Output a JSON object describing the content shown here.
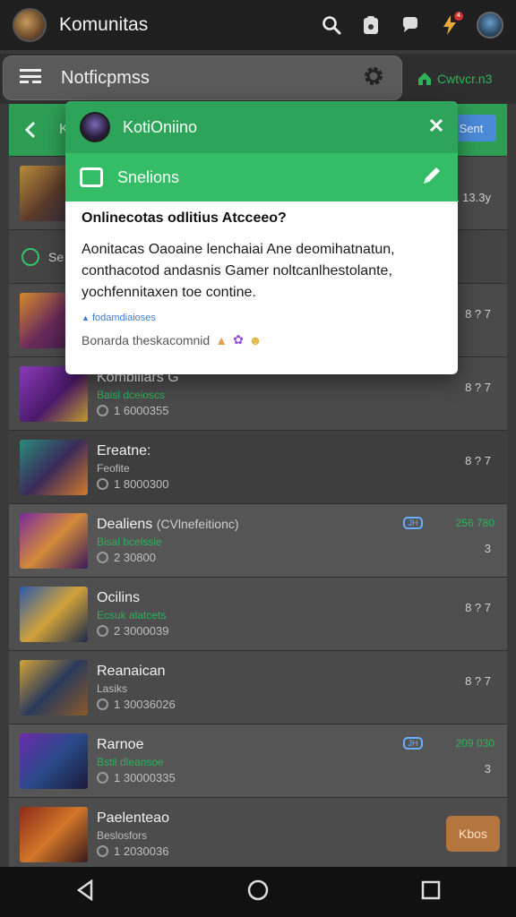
{
  "appbar": {
    "title": "Komunitas",
    "notification_count": "4"
  },
  "notifbar": {
    "title": "Notficpmss",
    "action_label": "Cwtvcr.n3"
  },
  "feed": {
    "header_label": "K",
    "header_button": "Sent",
    "rows": [
      {
        "time": "1 13.3y"
      },
      {
        "label": "Se"
      },
      {
        "right": "8 ? 7"
      },
      {
        "title": "Kombliiars G",
        "sub": "Baisl dceioscs",
        "meta": "1 6000355",
        "right": "8 ? 7"
      },
      {
        "title": "Ereatne:",
        "sub": "Feofite",
        "meta": "1 8000300",
        "right": "8 ? 7"
      },
      {
        "title": "Dealiens",
        "extra": "(CVlnefeitionc)",
        "sub": "Bisal bcelssie",
        "meta": "2 30800",
        "tag": "JH",
        "count": "256 780",
        "right": "3"
      },
      {
        "title": "Ocilins",
        "sub": "Ecsuk alatcets",
        "meta": "2 3000039",
        "right": "8 ? 7"
      },
      {
        "title": "Reanaican",
        "sub": "Lasiks",
        "meta": "1 30036026",
        "right": "8 ? 7"
      },
      {
        "title": "Rarnoe",
        "sub": "Bstil dleansoe",
        "meta": "1 30000335",
        "tag": "JH",
        "count": "209 030",
        "right": "3"
      },
      {
        "title": "Paelenteao",
        "sub": "Beslosfors",
        "meta": "1 2030036",
        "button": "Kbos"
      }
    ]
  },
  "modal": {
    "name": "KotiOniino",
    "section": "Snelions",
    "question": "Onlinecotas odlitius Atcceeo?",
    "body": "Aonitacas Oaoaine lenchaiai Ane deomihatnatun, conthacotod andasnis Gamer noltcanlhestolante, yochfennitaxen toe contine.",
    "link": "fodamdiaioses",
    "footer": "Bonarda theskacomnid"
  },
  "colors": {
    "green": "#2ea45a",
    "green_light": "#34bd66",
    "accent_blue": "#4a8ad9",
    "orange": "#b5753e"
  }
}
